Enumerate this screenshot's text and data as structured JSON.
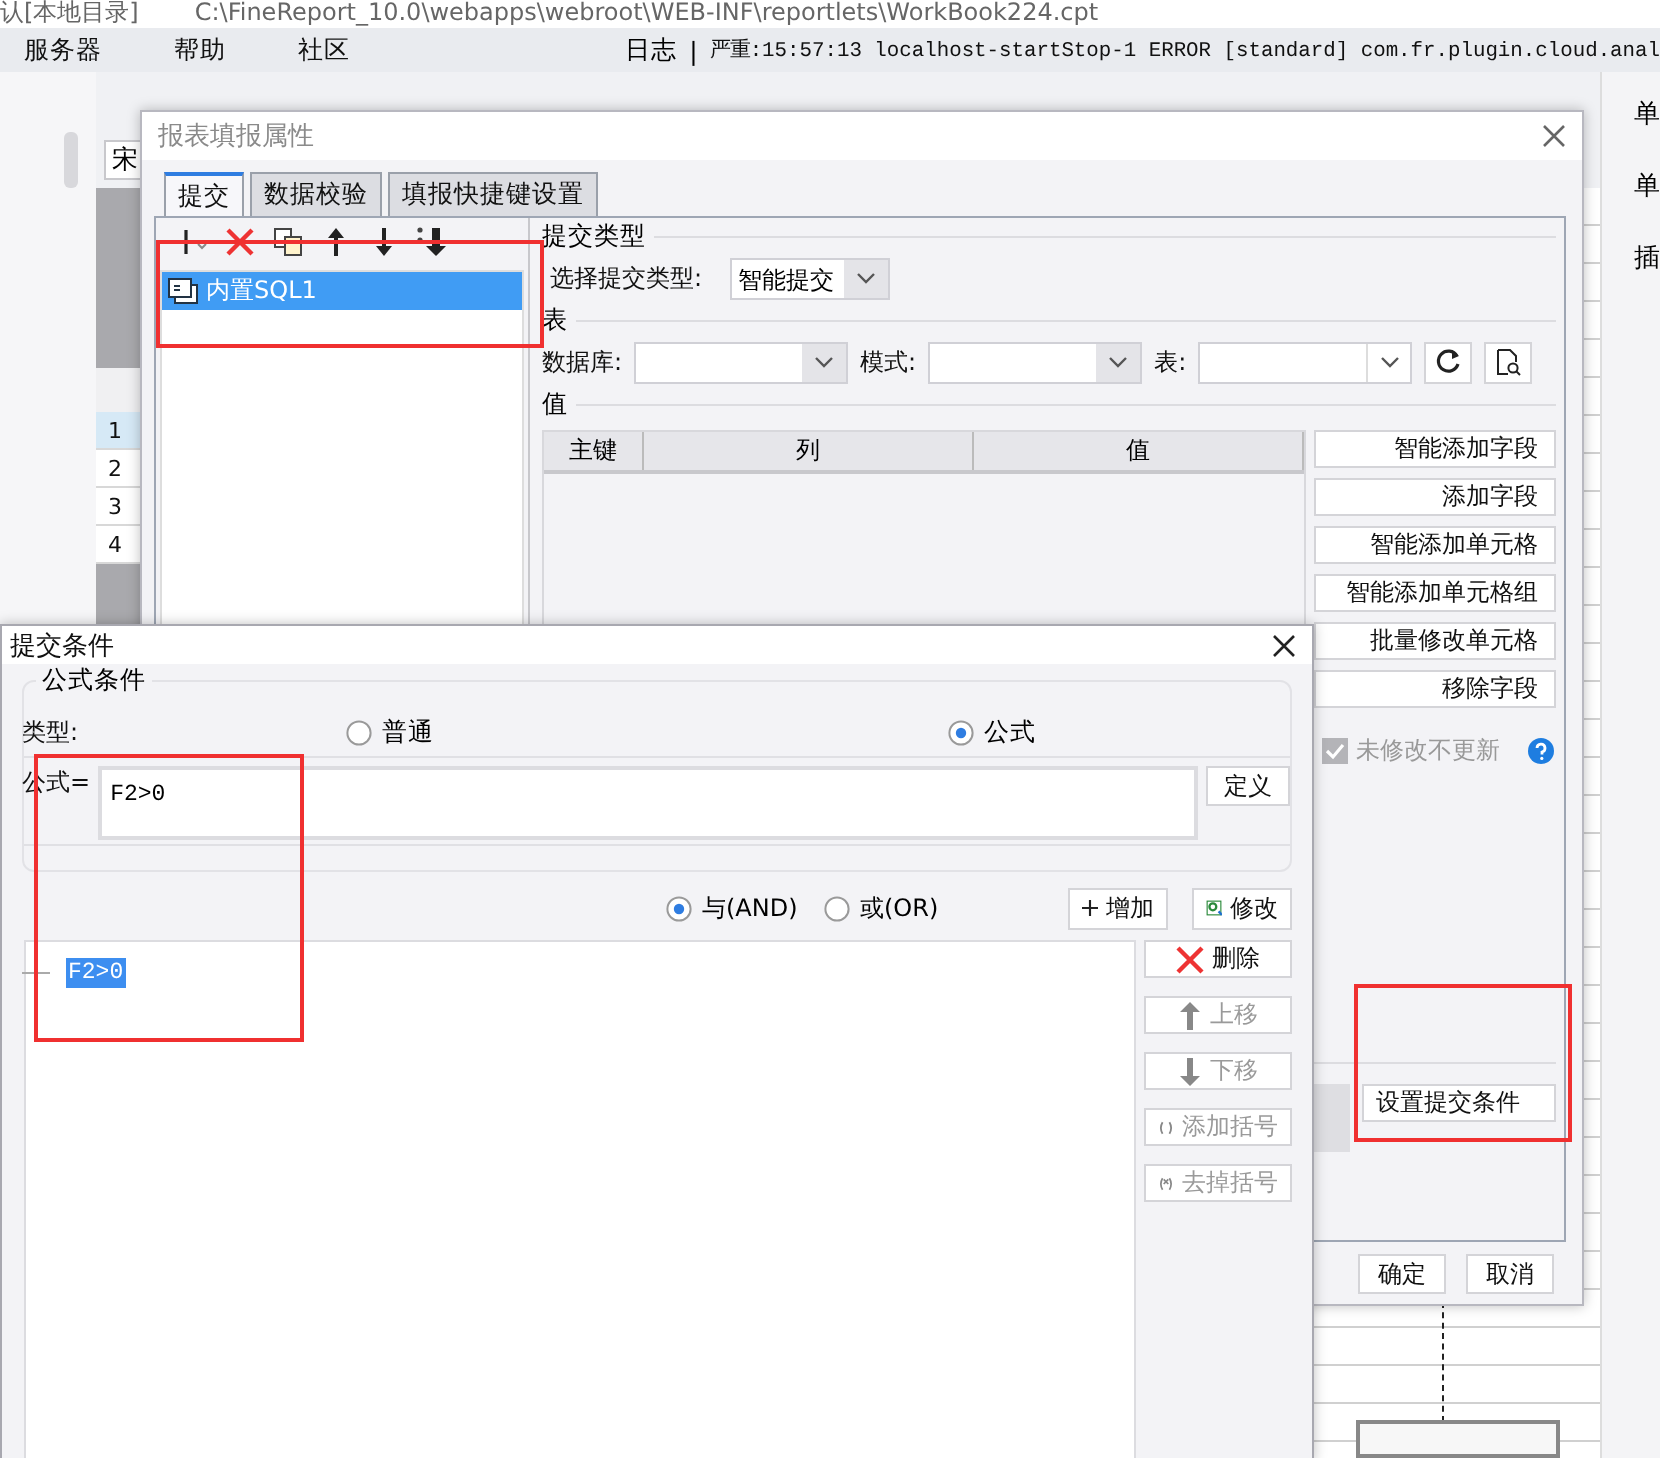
{
  "app": {
    "location": "认[本地目录]",
    "file_path": "C:\\FineReport_10.0\\webapps\\webroot\\WEB-INF\\reportlets\\WorkBook224.cpt",
    "menu": [
      "服务器",
      "帮助",
      "社区"
    ],
    "log_label": "日志",
    "log_separator": "|",
    "log_message": "严重:15:57:13 localhost-startStop-1 ERROR [standard] com.fr.plugin.cloud.anal",
    "font_field": "宋",
    "row_numbers": [
      "1",
      "2",
      "3",
      "4"
    ],
    "side_panel_labels": [
      "单",
      "单",
      "插"
    ]
  },
  "fill_dialog": {
    "title": "报表填报属性",
    "tabs": [
      {
        "label": "提交",
        "selected": true
      },
      {
        "label": "数据校验",
        "selected": false
      },
      {
        "label": "填报快捷键设置",
        "selected": false
      }
    ],
    "submissions": [
      {
        "label": "内置SQL1",
        "selected": true
      }
    ],
    "submit_type_group": "提交类型",
    "submit_type_label": "选择提交类型:",
    "submit_type_value": "智能提交",
    "table_group": "表",
    "database_label": "数据库:",
    "schema_label": "模式:",
    "table_label": "表:",
    "values_group": "值",
    "columns": [
      "主键",
      "列",
      "值"
    ],
    "field_buttons": [
      "智能添加字段",
      "添加字段",
      "智能添加单元格",
      "智能添加单元格组",
      "批量修改单元格",
      "移除字段"
    ],
    "unchanged_no_update": {
      "label": "未修改不更新",
      "checked": true,
      "disabled": true
    },
    "set_condition_button": "设置提交条件",
    "ok": "确定",
    "cancel": "取消"
  },
  "condition_dialog": {
    "title": "提交条件",
    "group": "公式条件",
    "type_label": "类型:",
    "types": [
      {
        "label": "普通",
        "selected": false
      },
      {
        "label": "公式",
        "selected": true
      }
    ],
    "formula_label": "公式=",
    "formula": "F2>0",
    "define_button": "定义",
    "joins": [
      {
        "label": "与(AND)",
        "selected": true
      },
      {
        "label": "或(OR)",
        "selected": false
      }
    ],
    "add_button": "增加",
    "modify_button": "修改",
    "conditions": [
      {
        "label": "F2>0",
        "selected": true
      }
    ],
    "side_buttons": [
      {
        "kind": "delete",
        "label": "删除",
        "disabled": false
      },
      {
        "kind": "up",
        "label": "上移",
        "disabled": true
      },
      {
        "kind": "down",
        "label": "下移",
        "disabled": true
      },
      {
        "kind": "add-paren",
        "label": "添加括号",
        "disabled": true
      },
      {
        "kind": "remove-paren",
        "label": "去掉括号",
        "disabled": true
      }
    ]
  },
  "annotations": [
    {
      "kind": "submission-list"
    },
    {
      "kind": "formula"
    },
    {
      "kind": "condition-button"
    }
  ]
}
